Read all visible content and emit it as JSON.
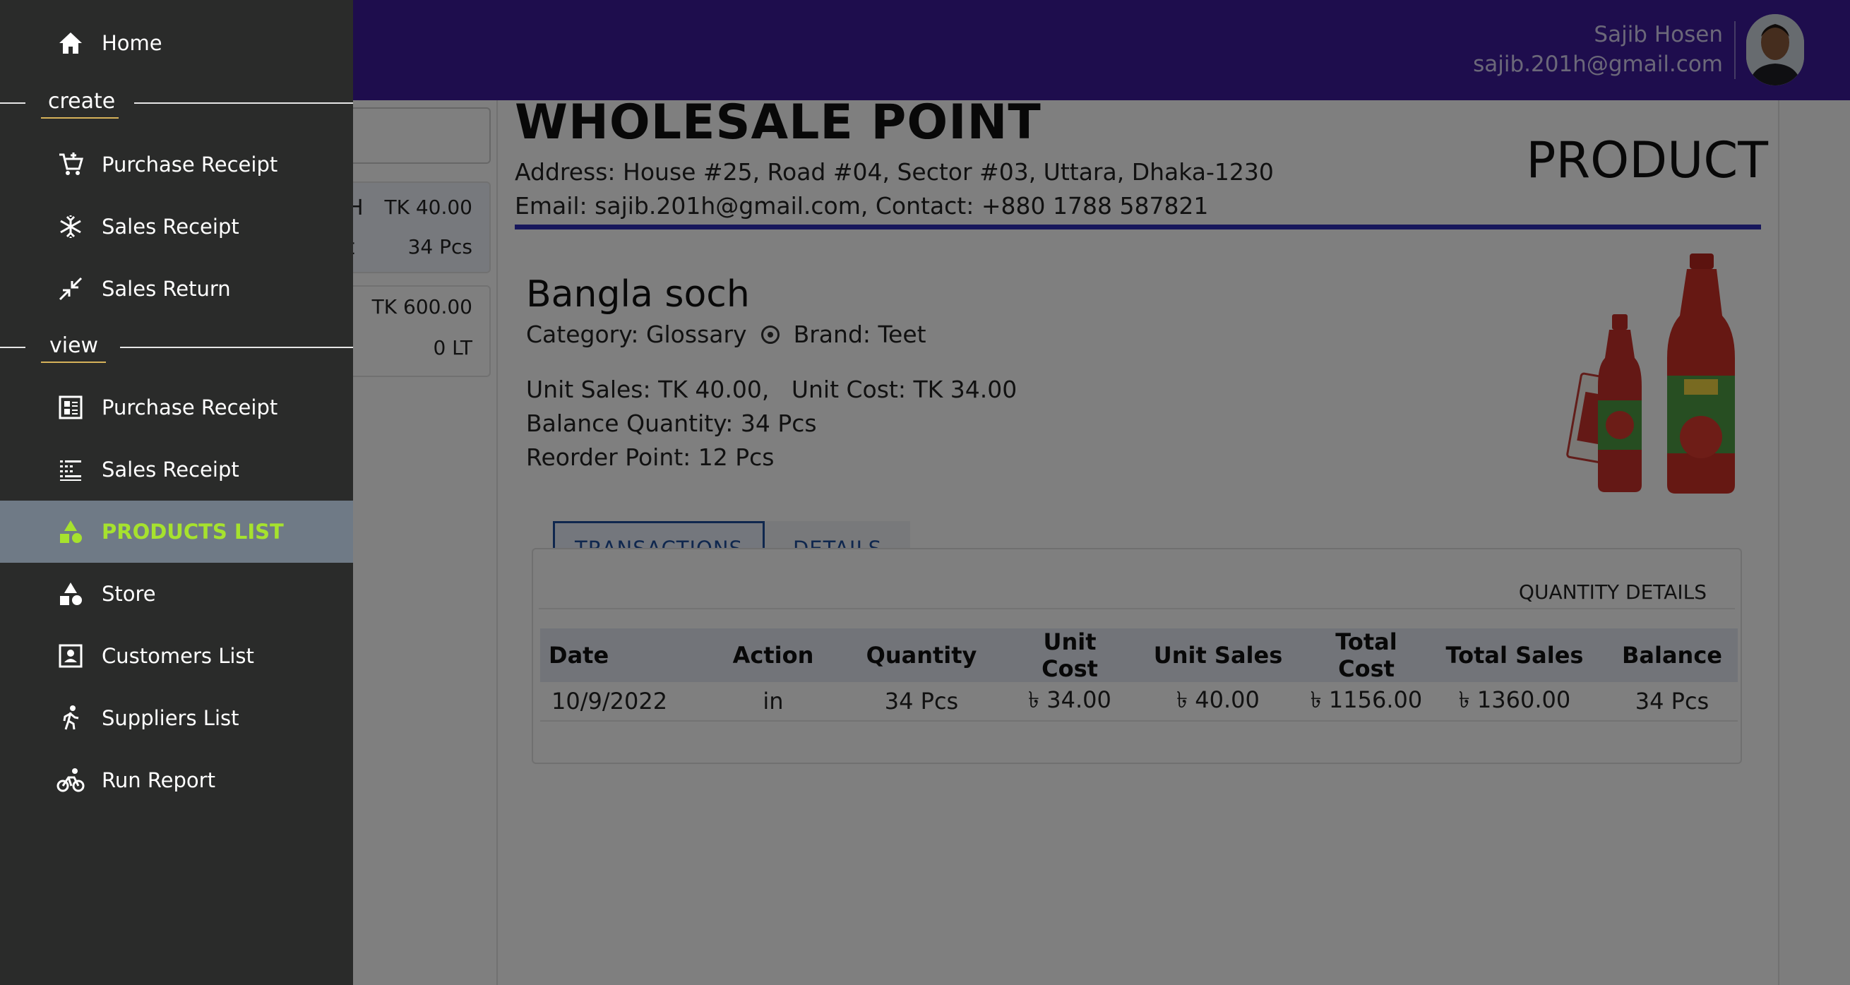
{
  "header": {
    "user_name": "Sajib Hosen",
    "user_email": "sajib.201h@gmail.com",
    "bar_color": "#3d1a9a"
  },
  "drawer": {
    "home": {
      "label": "Home",
      "icon": "home-icon"
    },
    "create_section": "create",
    "create_items": [
      {
        "label": "Purchase Receipt",
        "icon": "cart-add-icon"
      },
      {
        "label": "Sales Receipt",
        "icon": "snowflake-icon"
      },
      {
        "label": "Sales Return",
        "icon": "arrows-in-icon"
      }
    ],
    "view_section": "view",
    "view_items": [
      {
        "label": "Purchase Receipt",
        "icon": "receipt-grid-icon"
      },
      {
        "label": "Sales Receipt",
        "icon": "list-grid-icon"
      },
      {
        "label": "PRODUCTS LIST",
        "icon": "shapes-icon",
        "active": true
      },
      {
        "label": "Store",
        "icon": "shapes-icon"
      },
      {
        "label": "Customers List",
        "icon": "contact-card-icon"
      },
      {
        "label": "Suppliers List",
        "icon": "walking-icon"
      },
      {
        "label": "Run Report",
        "icon": "bike-icon"
      }
    ],
    "active_color": "#a6e22e"
  },
  "left_list": {
    "card1": {
      "label1": "H",
      "value1": "TK 40.00",
      "label2": "et",
      "value2": "34 Pcs"
    },
    "card2": {
      "value1": "TK 600.00",
      "value2": "0 LT"
    }
  },
  "document": {
    "shop_name": "WHOLESALE POINT",
    "address": "Address: House #25, Road #04, Sector #03, Uttara, Dhaka-1230",
    "contact": "Email: sajib.201h@gmail.com, Contact: +880 1788 587821",
    "doc_type": "PRODUCT",
    "rule_color": "#2f2fb8"
  },
  "product": {
    "name": "Bangla soch",
    "category": "Category: Glossary",
    "brand": "Brand: Teet",
    "unit_sales": "Unit Sales: TK 40.00,",
    "unit_cost": "Unit Cost: TK 34.00",
    "balance_qty": "Balance Quantity: 34 Pcs",
    "reorder_point": "Reorder Point: 12 Pcs"
  },
  "tabs": [
    {
      "label": "TRANSACTIONS",
      "active": true
    },
    {
      "label": "DETAILS",
      "active": false
    }
  ],
  "transactions": {
    "section_title": "QUANTITY DETAILS",
    "columns": [
      "Date",
      "Action",
      "Quantity",
      "Unit Cost",
      "Unit Sales",
      "Total Cost",
      "Total Sales",
      "Balance"
    ],
    "rows": [
      [
        "10/9/2022",
        "in",
        "34 Pcs",
        "৳ 34.00",
        "৳ 40.00",
        "৳ 1156.00",
        "৳ 1360.00",
        "34 Pcs"
      ]
    ]
  }
}
